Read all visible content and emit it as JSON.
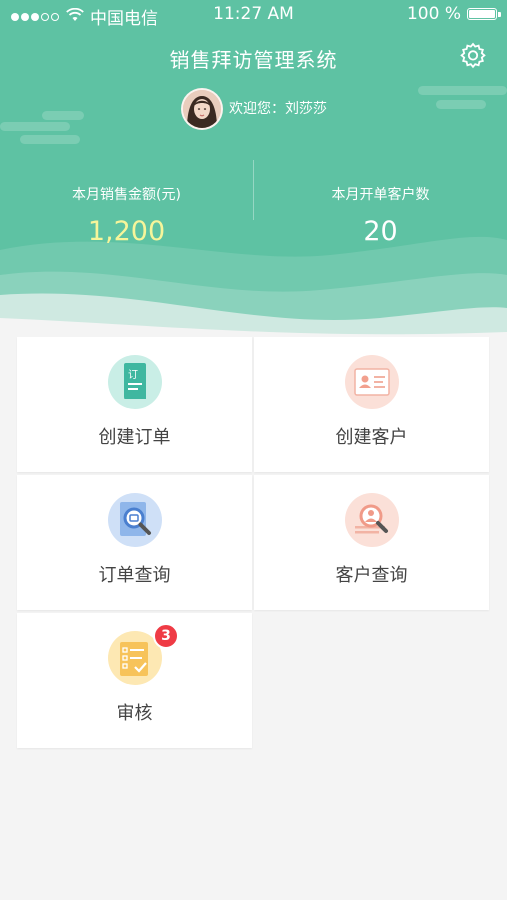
{
  "status_bar": {
    "carrier": "中国电信",
    "time": "11:27 AM",
    "battery": "100 %",
    "battery_level": 1.0
  },
  "header": {
    "title": "销售拜访管理系统",
    "welcome": "欢迎您：刘莎莎"
  },
  "stats": {
    "monthly_sales_label": "本月销售金额(元)",
    "monthly_sales_value": "1,200",
    "monthly_customers_label": "本月开单客户数",
    "monthly_customers_value": "20"
  },
  "tiles": {
    "create_order": "创建订单",
    "create_customer": "创建客户",
    "order_query": "订单查询",
    "customer_query": "客户查询",
    "review": "审核",
    "review_badge": "3"
  },
  "colors": {
    "header_green": "#5ec2a3",
    "accent_yellow": "#f7f59a",
    "badge_red": "#ef3b45"
  },
  "icons": {
    "settings": "gear-icon",
    "create_order": "order-doc-icon",
    "create_customer": "customer-card-icon",
    "order_query": "order-search-icon",
    "customer_query": "customer-search-icon",
    "review": "checklist-icon"
  }
}
